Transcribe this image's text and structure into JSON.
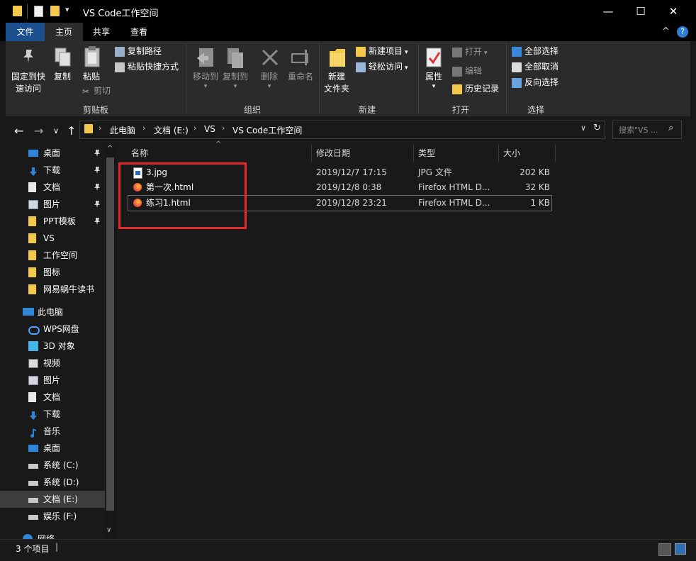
{
  "window": {
    "title": "VS Code工作空间",
    "minimize_glyph": "—",
    "maximize_glyph": "☐",
    "close_glyph": "✕",
    "qa_dropdown_glyph": "▾",
    "help_glyph": "?",
    "collapse_glyph": "^"
  },
  "tabs": [
    {
      "label": "文件"
    },
    {
      "label": "主页"
    },
    {
      "label": "共享"
    },
    {
      "label": "查看"
    }
  ],
  "ribbon": {
    "clipboard": {
      "group_label": "剪贴板",
      "pin_label_1": "固定到快",
      "pin_label_2": "速访问",
      "copy_label": "复制",
      "paste_label": "粘贴",
      "copy_path": "复制路径",
      "paste_shortcut": "粘贴快捷方式",
      "cut": "剪切"
    },
    "organize": {
      "group_label": "组织",
      "move_to": "移动到",
      "copy_to": "复制到",
      "delete": "删除",
      "rename": "重命名"
    },
    "new": {
      "group_label": "新建",
      "new_folder_1": "新建",
      "new_folder_2": "文件夹",
      "new_item": "新建项目",
      "easy_access": "轻松访问"
    },
    "open": {
      "group_label": "打开",
      "properties": "属性",
      "open": "打开",
      "edit": "编辑",
      "history": "历史记录"
    },
    "select": {
      "group_label": "选择",
      "select_all": "全部选择",
      "select_none": "全部取消",
      "invert": "反向选择"
    }
  },
  "nav": {
    "back_glyph": "←",
    "forward_glyph": "→",
    "history_glyph": "∨",
    "up_glyph": "↑",
    "refresh_glyph": "↻",
    "breadcrumb": [
      "此电脑",
      "文档 (E:)",
      "VS",
      "VS Code工作空间"
    ],
    "breadcrumb_sep": "›",
    "search_placeholder": "搜索\"VS ...",
    "search_glyph": "⌕",
    "address_dropdown_glyph": "∨"
  },
  "sidebar": {
    "pin_glyph": "📌",
    "scroll_up_glyph": "^",
    "scroll_down_glyph": "∨",
    "items": [
      {
        "label": "桌面",
        "icon": "desktop-icon",
        "pinned": true
      },
      {
        "label": "下载",
        "icon": "download-icon",
        "pinned": true
      },
      {
        "label": "文档",
        "icon": "document-icon",
        "pinned": true
      },
      {
        "label": "图片",
        "icon": "picture-icon",
        "pinned": true
      },
      {
        "label": "PPT模板",
        "icon": "folder-icon",
        "pinned": true
      },
      {
        "label": "VS",
        "icon": "folder-icon",
        "pinned": false
      },
      {
        "label": "工作空间",
        "icon": "folder-icon",
        "pinned": false
      },
      {
        "label": "图标",
        "icon": "folder-icon",
        "pinned": false
      },
      {
        "label": "网易蜗牛读书",
        "icon": "folder-icon",
        "pinned": false
      },
      {
        "label": "此电脑",
        "icon": "computer-icon",
        "pinned": false
      },
      {
        "label": "WPS网盘",
        "icon": "cloud-icon",
        "pinned": false
      },
      {
        "label": "3D 对象",
        "icon": "cube-icon",
        "pinned": false
      },
      {
        "label": "视频",
        "icon": "video-icon",
        "pinned": false
      },
      {
        "label": "图片",
        "icon": "picture-icon",
        "pinned": false
      },
      {
        "label": "文档",
        "icon": "document-icon",
        "pinned": false
      },
      {
        "label": "下载",
        "icon": "download-icon",
        "pinned": false
      },
      {
        "label": "音乐",
        "icon": "music-icon",
        "pinned": false
      },
      {
        "label": "桌面",
        "icon": "desktop-icon",
        "pinned": false
      },
      {
        "label": "系统 (C:)",
        "icon": "drive-icon",
        "pinned": false
      },
      {
        "label": "系统 (D:)",
        "icon": "drive-icon",
        "pinned": false
      },
      {
        "label": "文档 (E:)",
        "icon": "drive-icon",
        "pinned": false,
        "selected": true
      },
      {
        "label": "娱乐 (F:)",
        "icon": "drive-icon",
        "pinned": false
      },
      {
        "label": "网络",
        "icon": "network-icon",
        "pinned": false
      }
    ]
  },
  "columns": {
    "name": "名称",
    "modified": "修改日期",
    "type": "类型",
    "size": "大小",
    "sort_glyph": "^"
  },
  "files": [
    {
      "name": "3.jpg",
      "modified": "2019/12/7 17:15",
      "type": "JPG 文件",
      "size": "202 KB",
      "icon": "jpg-file-icon"
    },
    {
      "name": "第一次.html",
      "modified": "2019/12/8 0:38",
      "type": "Firefox HTML D...",
      "size": "32 KB",
      "icon": "firefox-html-icon"
    },
    {
      "name": "练习1.html",
      "modified": "2019/12/8 23:21",
      "type": "Firefox HTML D...",
      "size": "1 KB",
      "icon": "firefox-html-icon"
    }
  ],
  "status": {
    "item_count": "3 个项目",
    "separator": "|"
  },
  "colors": {
    "background": "#191919",
    "ribbon": "#2b2b2b",
    "file_tab": "#1b4f8e",
    "highlight_box": "#e52a2a",
    "folder": "#f4c84a"
  }
}
